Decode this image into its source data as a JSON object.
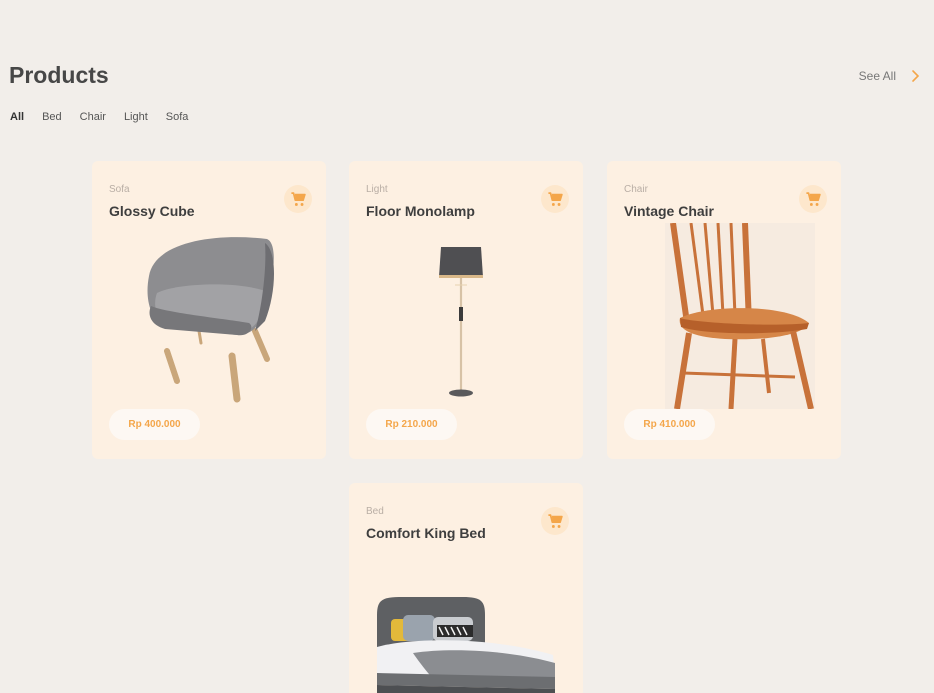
{
  "section": {
    "title": "Products",
    "see_all_label": "See All"
  },
  "filters": [
    {
      "label": "All",
      "active": true
    },
    {
      "label": "Bed",
      "active": false
    },
    {
      "label": "Chair",
      "active": false
    },
    {
      "label": "Light",
      "active": false
    },
    {
      "label": "Sofa",
      "active": false
    }
  ],
  "products": [
    {
      "category": "Sofa",
      "name": "Glossy Cube",
      "price": "Rp 400.000",
      "image": "armchair-image"
    },
    {
      "category": "Light",
      "name": "Floor Monolamp",
      "price": "Rp 210.000",
      "image": "floor-lamp-image"
    },
    {
      "category": "Chair",
      "name": "Vintage Chair",
      "price": "Rp 410.000",
      "image": "wooden-chair-image"
    },
    {
      "category": "Bed",
      "name": "Comfort King Bed",
      "price": "",
      "image": "king-bed-image"
    }
  ],
  "colors": {
    "background": "#f2eeea",
    "card": "#fdf0e2",
    "accent": "#f4a64a"
  }
}
